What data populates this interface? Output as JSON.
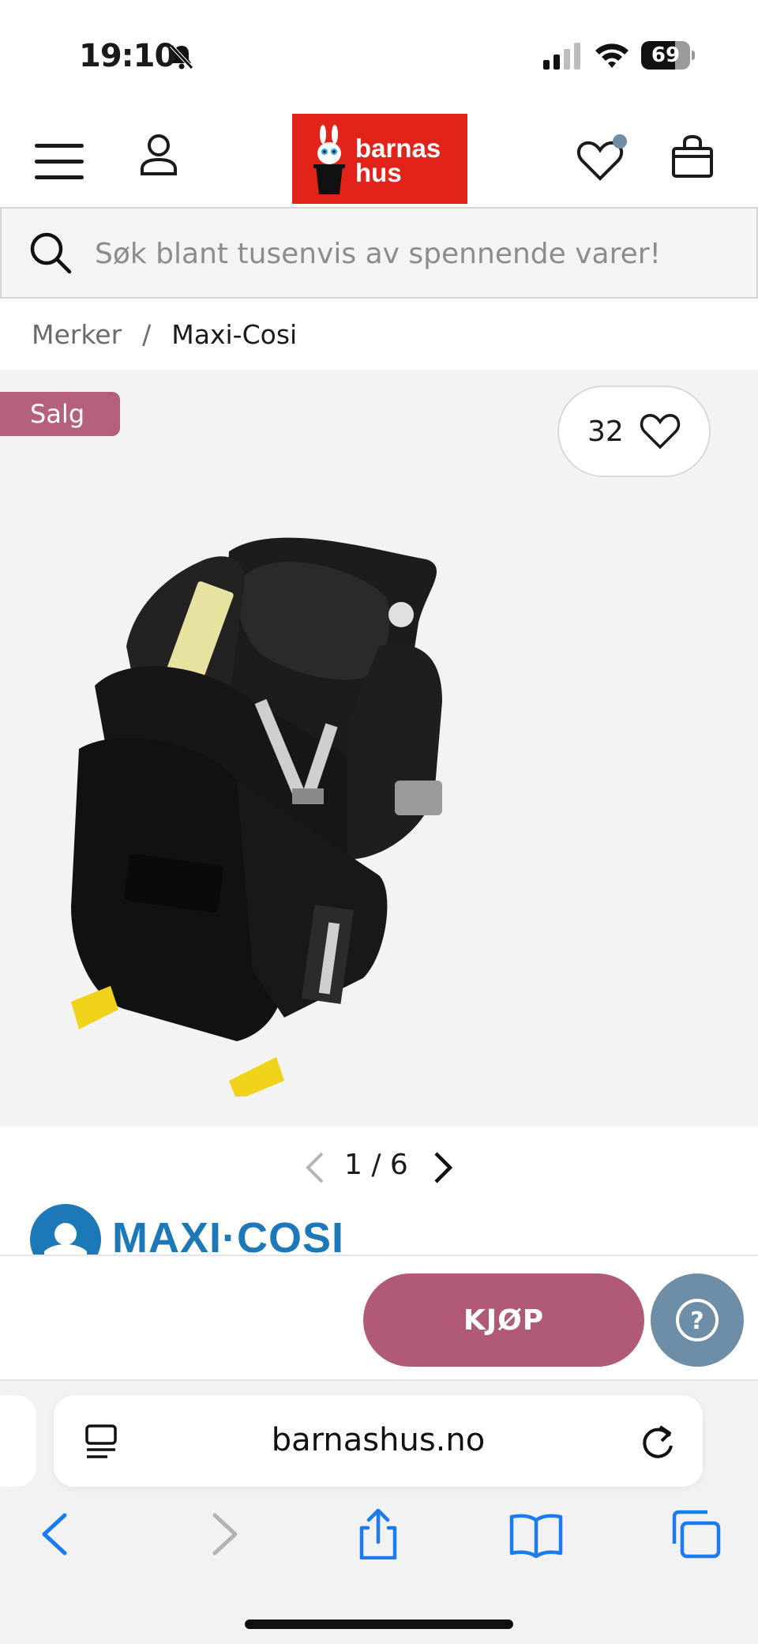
{
  "status_bar": {
    "time": "19:10",
    "battery_percent": "69",
    "battery_level": 0.69
  },
  "header": {
    "logo_line1": "barnas",
    "logo_line2": "hus",
    "icons": [
      "menu-icon",
      "user-icon",
      "heart-icon",
      "shopping-bag-icon"
    ],
    "colors": {
      "logo_red": "#e2231a",
      "notification_dot": "#6f8ea3"
    }
  },
  "search": {
    "placeholder": "Søk blant tusenvis av spennende varer!"
  },
  "breadcrumb": {
    "items": [
      "Merker",
      "Maxi-Cosi"
    ],
    "separator": "/"
  },
  "product": {
    "sale_badge": "Salg",
    "likes": "32",
    "image_alt": "black car seat",
    "pager": {
      "current": 1,
      "total": 6,
      "label": "1 / 6"
    },
    "brand": "MAXI·COSI",
    "colors": {
      "sale": "#b5617c",
      "brand_blue": "#1d78b8"
    }
  },
  "buy_bar": {
    "buy_label": "KJØP",
    "help_label": "?",
    "colors": {
      "buy": "#b05a78",
      "help": "#6d8ea6"
    }
  },
  "browser": {
    "url": "barnashus.no",
    "toolbar": [
      "back-icon",
      "forward-icon",
      "share-icon",
      "bookmarks-icon",
      "tabs-icon"
    ],
    "accent": "#1a7cf0"
  }
}
